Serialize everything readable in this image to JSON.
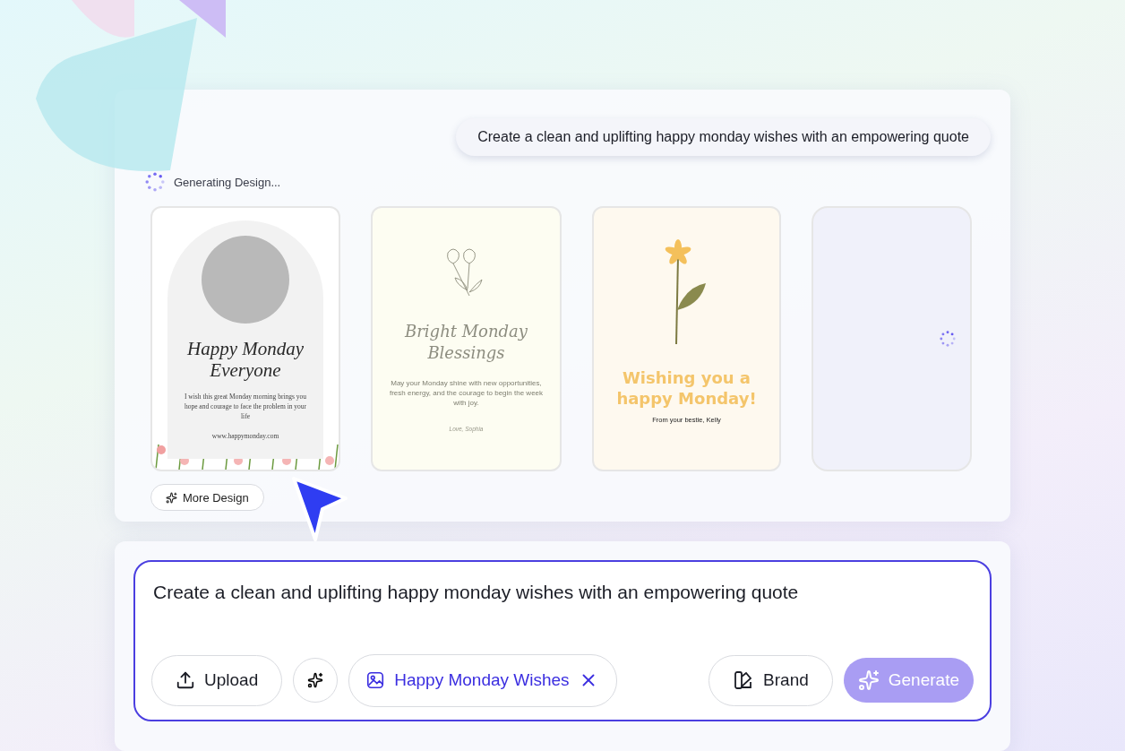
{
  "prompt_bubble": "Create a clean and uplifting happy monday wishes with an empowering quote",
  "status": {
    "text": "Generating Design...",
    "loading": true
  },
  "designs": [
    {
      "kind": "photo",
      "title": "Happy Monday Everyone",
      "body": "I wish this great Monday morning brings you hope and courage to face the problem in your life",
      "footer": "www.happymonday.com"
    },
    {
      "kind": "script",
      "title": "Bright Monday Blessings",
      "body": "May your Monday shine with new opportunities, fresh energy, and the courage to begin the week with joy.",
      "footer": "Love, Sophia"
    },
    {
      "kind": "bold",
      "title": "Wishing you a happy Monday!",
      "footer": "From your bestie, Kelly"
    },
    {
      "kind": "loading"
    }
  ],
  "more_button": "More Design",
  "composer": {
    "value": "Create a clean and uplifting happy monday wishes with an empowering quote",
    "upload": "Upload",
    "tag": "Happy Monday Wishes",
    "brand": "Brand",
    "generate": {
      "label": "Generate",
      "disabled": true
    }
  }
}
